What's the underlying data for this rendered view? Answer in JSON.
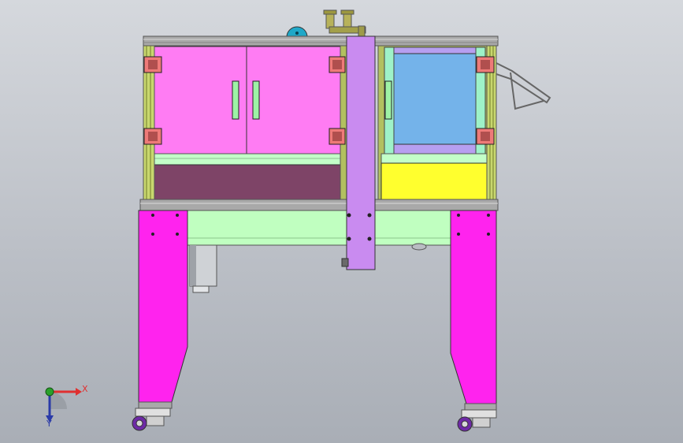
{
  "viewport": {
    "background_top": "#d5d8dd",
    "background_bottom": "#a9aeb6"
  },
  "model": {
    "colors": {
      "frame_rail": "#a9a9a9",
      "frame_upright": "#c8d76e",
      "left_doors": "#ff7cf3",
      "door_handle": "#9ef2a6",
      "left_lower_panel": "#7e4467",
      "right_window": "#74b3ea",
      "right_window_trim": "#b79ff0",
      "right_lower_panel": "#ffff2e",
      "central_column": "#c98bf0",
      "base_panel": "#c0ffc0",
      "legs": "#ff23ee",
      "hinge_brackets": "#ee7a78",
      "motor": "#cfd2d6",
      "casters": "#6e2aa6",
      "disk": "#20a8c8",
      "nozzle_block": "#b7b25a"
    }
  },
  "triad": {
    "x_label": "X",
    "y_label": "Y",
    "x_color": "#e03030",
    "y_color": "#2aa02a",
    "z_color": "#2a3aa8"
  }
}
